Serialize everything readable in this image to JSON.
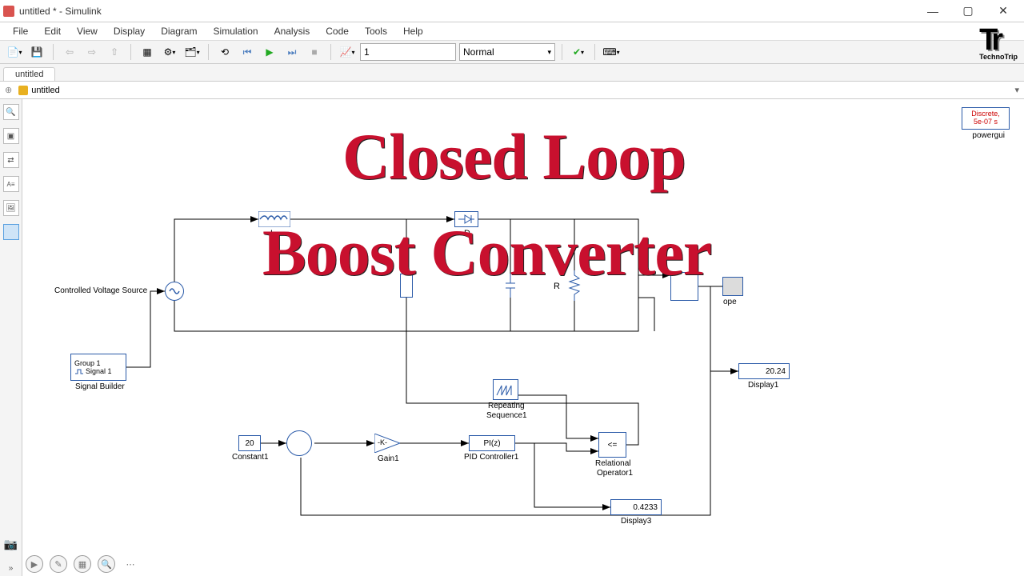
{
  "window": {
    "title": "untitled * - Simulink",
    "min": "—",
    "max": "▢",
    "close": "✕"
  },
  "menu": [
    "File",
    "Edit",
    "View",
    "Display",
    "Diagram",
    "Simulation",
    "Analysis",
    "Code",
    "Tools",
    "Help"
  ],
  "toolbar": {
    "stop_time": "1",
    "sim_mode": "Normal"
  },
  "tabs": {
    "active": "untitled"
  },
  "breadcrumb": {
    "path": "untitled"
  },
  "overlay": {
    "line1": "Closed Loop",
    "line2": "Boost Converter"
  },
  "logo": {
    "main": "Tr",
    "sub": "TechnoTrip"
  },
  "canvas": {
    "powergui": {
      "line1": "Discrete,",
      "line2": "5e-07 s",
      "label": "powergui"
    },
    "controlled_voltage_source": "Controlled Voltage Source",
    "signal_builder": {
      "group": "Group 1",
      "signal": "Signal 1",
      "label": "Signal Builder"
    },
    "inductor_label": "L",
    "diode_label": "D",
    "resistor_label": "R",
    "scope_label": "ope",
    "display1": {
      "value": "20.24",
      "label": "Display1"
    },
    "display3": {
      "value": "0.4233",
      "label": "Display3"
    },
    "repeating_seq": {
      "label1": "Repeating",
      "label2": "Sequence1"
    },
    "constant": {
      "value": "20",
      "label": "Constant1"
    },
    "gain": {
      "value": "-K-",
      "label": "Gain1"
    },
    "pid": {
      "value": "PI(z)",
      "label": "PID Controller1"
    },
    "relop": {
      "value": "<=",
      "label1": "Relational",
      "label2": "Operator1"
    }
  },
  "colors": {
    "block_border": "#2a5aa8",
    "overlay_red": "#c8102e"
  }
}
